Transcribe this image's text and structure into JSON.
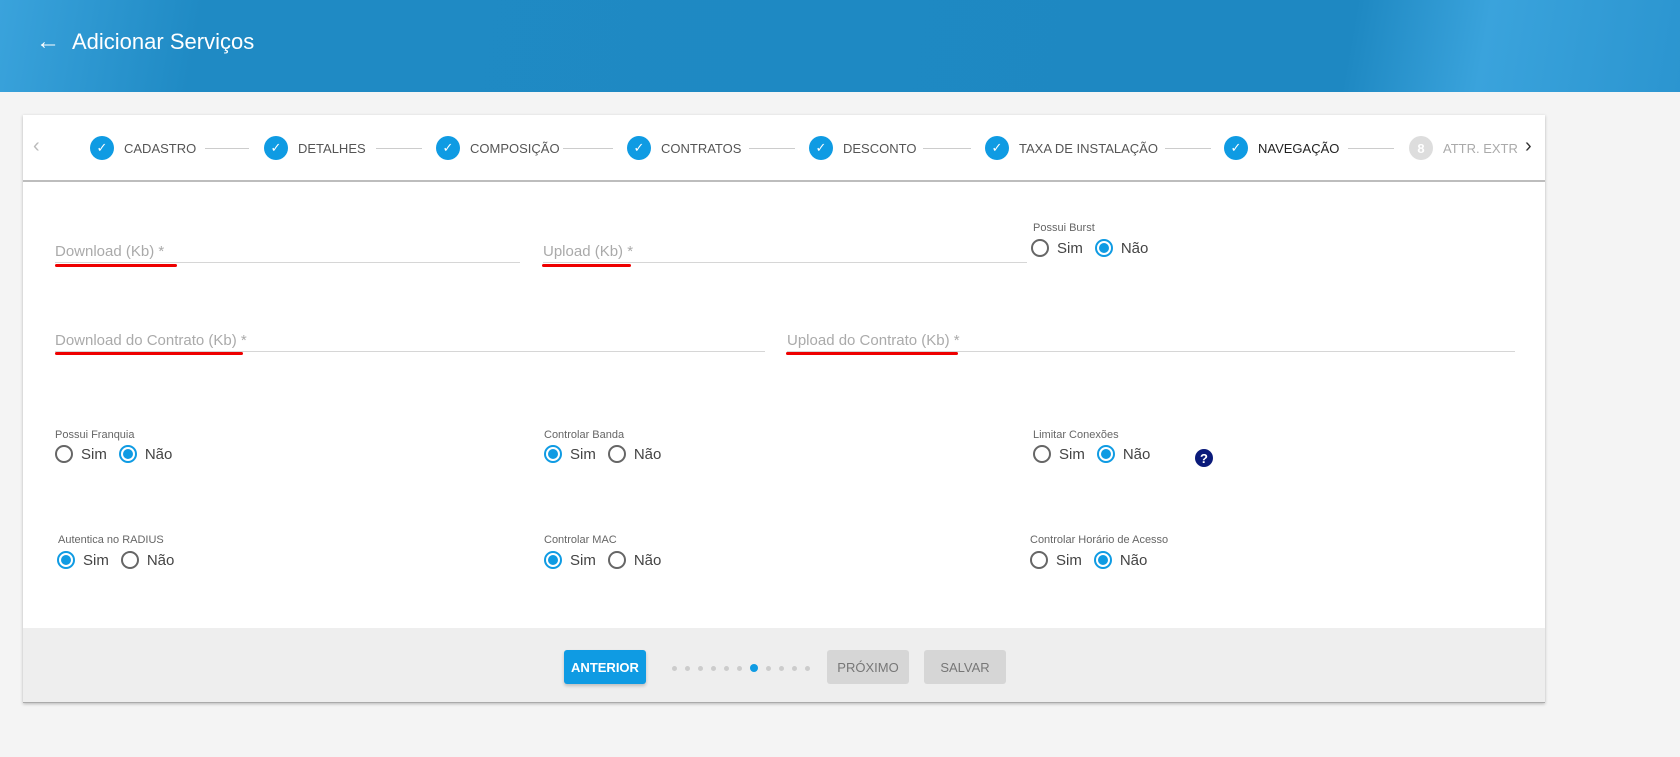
{
  "header": {
    "title": "Adicionar Serviços",
    "back_icon": "arrow-left-icon"
  },
  "stepper": {
    "steps": [
      {
        "label": "CADASTRO",
        "state": "done"
      },
      {
        "label": "DETALHES",
        "state": "done"
      },
      {
        "label": "COMPOSIÇÃO",
        "state": "done"
      },
      {
        "label": "CONTRATOS",
        "state": "done"
      },
      {
        "label": "DESCONTO",
        "state": "done"
      },
      {
        "label": "TAXA DE INSTALAÇÃO",
        "state": "done"
      },
      {
        "label": "NAVEGAÇÃO",
        "state": "current"
      },
      {
        "label": "ATTR. EXTR",
        "state": "pending",
        "number": "8"
      }
    ]
  },
  "fields": {
    "download": "Download (Kb) *",
    "upload": "Upload (Kb) *",
    "download_contrato": "Download do Contrato (Kb) *",
    "upload_contrato": "Upload do Contrato (Kb) *"
  },
  "options": {
    "sim": "Sim",
    "nao": "Não"
  },
  "groups": [
    {
      "label": "Possui Burst",
      "value": "Não"
    },
    {
      "label": "Possui Franquia",
      "value": "Não"
    },
    {
      "label": "Controlar Banda",
      "value": "Sim"
    },
    {
      "label": "Limitar Conexões",
      "value": "Não"
    },
    {
      "label": "Autentica no RADIUS",
      "value": "Sim"
    },
    {
      "label": "Controlar MAC",
      "value": "Sim"
    },
    {
      "label": "Controlar Horário de Acesso",
      "value": "Não"
    }
  ],
  "footer": {
    "anterior": "ANTERIOR",
    "proximo": "PRÓXIMO",
    "salvar": "SALVAR",
    "page_dots": 11,
    "active_dot": 7
  },
  "colors": {
    "accent": "#0f9be3",
    "header": "#1e88c2",
    "annotation": "#e00000"
  }
}
